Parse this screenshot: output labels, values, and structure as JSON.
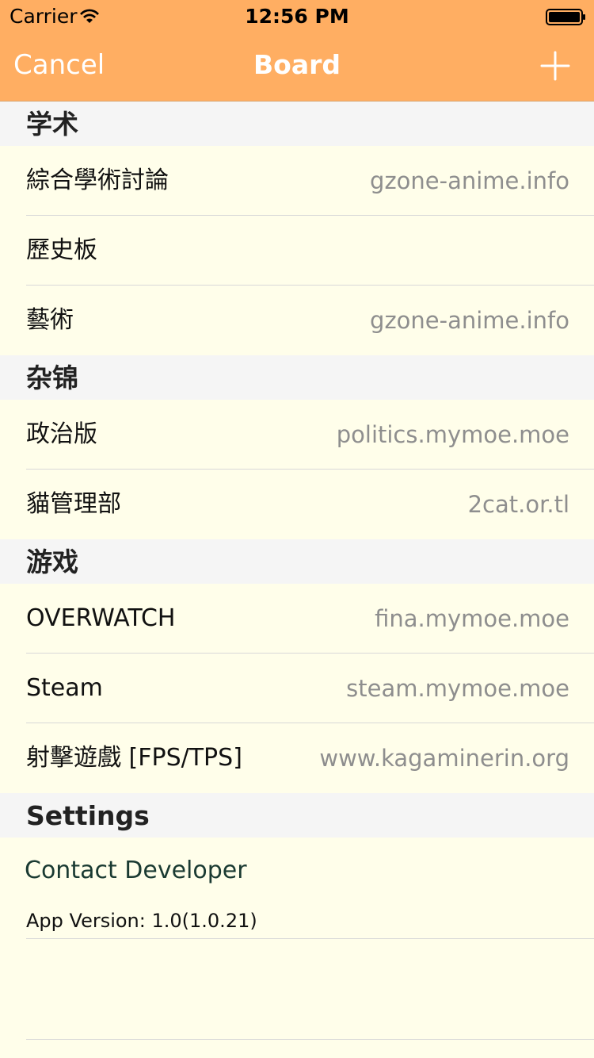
{
  "status_bar": {
    "carrier": "Carrier",
    "time": "12:56 PM"
  },
  "nav": {
    "cancel_label": "Cancel",
    "title": "Board",
    "add_icon": "plus-icon"
  },
  "colors": {
    "nav_background": "#ffae62",
    "page_background": "#fffeea",
    "section_background": "#f5f5f5",
    "detail_text": "#8e8e8e",
    "contact_text": "#1a3a32"
  },
  "sections": [
    {
      "title": "学术",
      "rows": [
        {
          "title": "綜合學術討論",
          "detail": "gzone-anime.info"
        },
        {
          "title": "歷史板",
          "detail": ""
        },
        {
          "title": "藝術",
          "detail": "gzone-anime.info"
        }
      ]
    },
    {
      "title": "杂锦",
      "rows": [
        {
          "title": "政治版",
          "detail": "politics.mymoe.moe"
        },
        {
          "title": "貓管理部",
          "detail": "2cat.or.tl"
        }
      ]
    },
    {
      "title": "游戏",
      "rows": [
        {
          "title": "OVERWATCH",
          "detail": "fina.mymoe.moe"
        },
        {
          "title": "Steam",
          "detail": "steam.mymoe.moe"
        },
        {
          "title": "射擊遊戲 [FPS/TPS]",
          "detail": "www.kagaminerin.org"
        }
      ]
    }
  ],
  "settings": {
    "title": "Settings",
    "contact_label": "Contact Developer",
    "version_text": "App Version: 1.0(1.0.21)"
  }
}
